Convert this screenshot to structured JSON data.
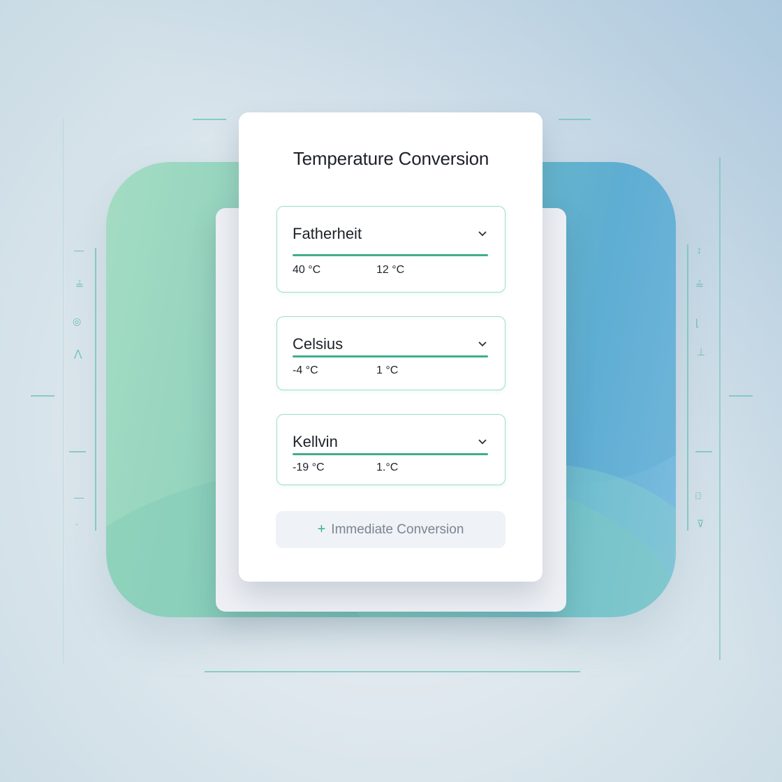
{
  "title": "Temperature Conversion",
  "fields": [
    {
      "label": "Fatherheit",
      "value1": "40  °C",
      "value2": "12 °C"
    },
    {
      "label": "Celsius",
      "value1": "-4 °C",
      "value2": "1 °C"
    },
    {
      "label": "Kellvin",
      "value1": "-19 °C",
      "value2": "1.°C"
    }
  ],
  "button": {
    "label": "Immediate Conversion",
    "icon": "+"
  },
  "colors": {
    "accent": "#3fae8c",
    "border": "#9fdcd1",
    "title": "#1d2128"
  }
}
